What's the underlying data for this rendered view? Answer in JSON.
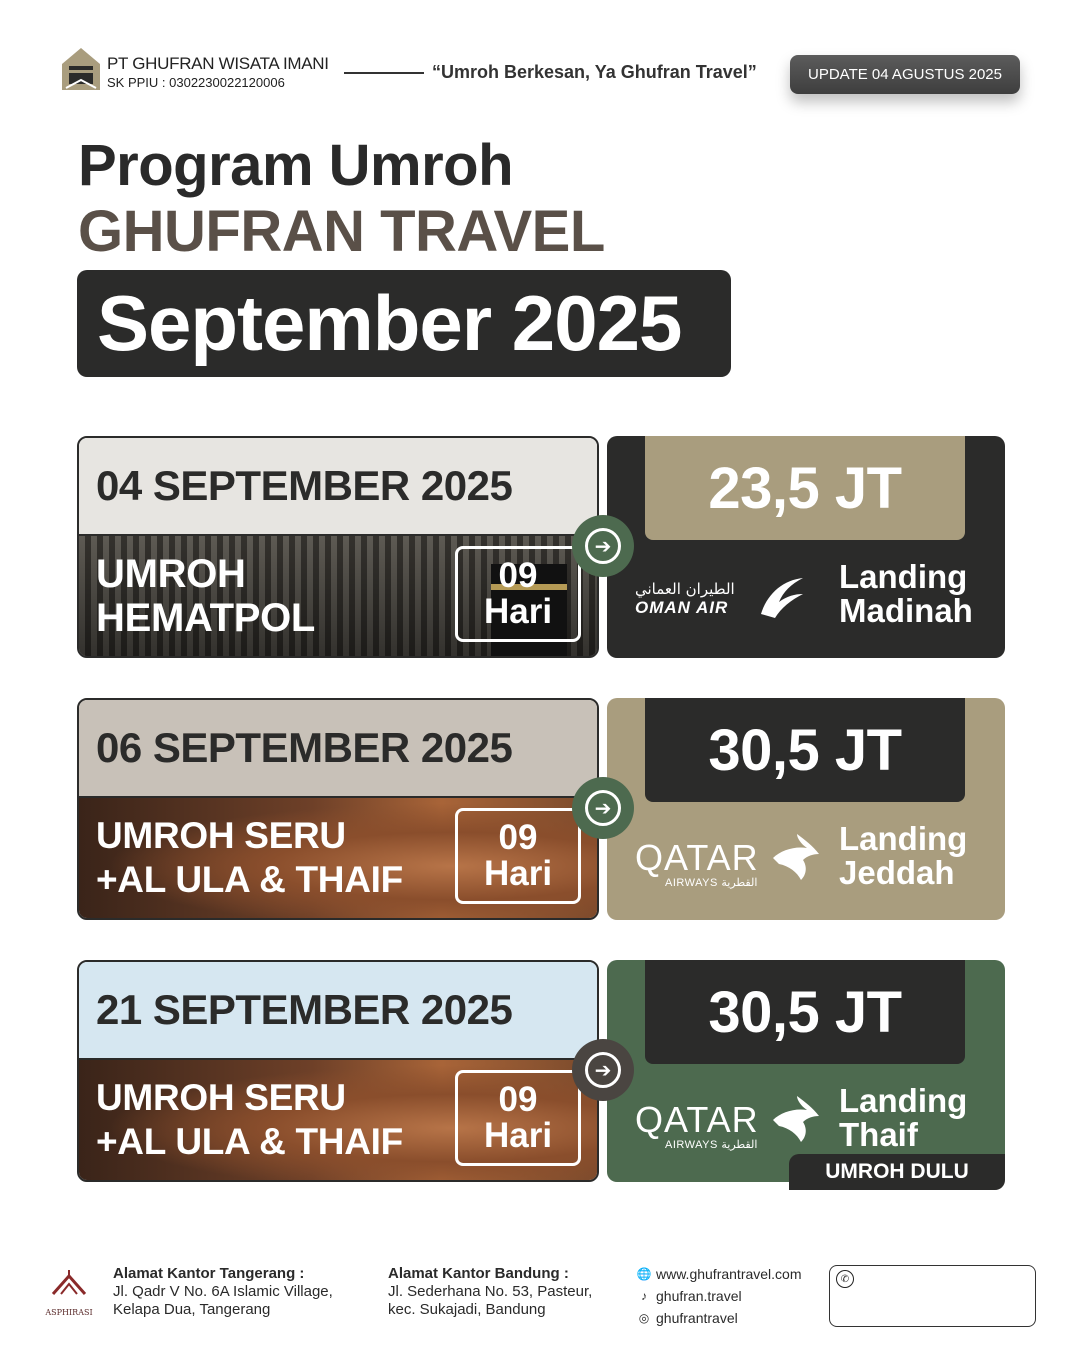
{
  "header": {
    "company_name": "PT GHUFRAN WISATA IMANI",
    "license": "SK PPIU : 0302230022120006",
    "tagline": "“Umroh Berkesan, Ya Ghufran Travel”",
    "update_badge": "UPDATE 04 AGUSTUS 2025"
  },
  "title": {
    "line1": "Program Umroh",
    "line2": "GHUFRAN TRAVEL",
    "month": "September 2025"
  },
  "colors": {
    "dark": "#2b2b2a",
    "tan": "#a99d7e",
    "light_gray": "#e7e5e1",
    "light_tan": "#c8c1b8",
    "light_blue": "#d6e7f1",
    "green": "#4d6a4f"
  },
  "programs": [
    {
      "date": "04 SEPTEMBER 2025",
      "name_line1": "UMROH",
      "name_line2": "HEMATPOL",
      "days_num": "09",
      "days_unit": "Hari",
      "price": "23,5 JT",
      "airline_arabic": "الطيران العماني",
      "airline_name": "OMAN AIR",
      "landing_line1": "Landing",
      "landing_line2": "Madinah",
      "icon": "arrow-right-icon"
    },
    {
      "date": "06 SEPTEMBER 2025",
      "name_line1": "UMROH SERU",
      "name_line2": "+AL ULA & THAIF",
      "days_num": "09",
      "days_unit": "Hari",
      "price": "30,5 JT",
      "airline_name": "QATAR",
      "airline_sub": "AIRWAYS القطرية",
      "landing_line1": "Landing",
      "landing_line2": "Jeddah",
      "icon": "arrow-right-icon"
    },
    {
      "date": "21 SEPTEMBER 2025",
      "name_line1": "UMROH SERU",
      "name_line2": "+AL ULA & THAIF",
      "days_num": "09",
      "days_unit": "Hari",
      "price": "30,5 JT",
      "airline_name": "QATAR",
      "airline_sub": "AIRWAYS القطرية",
      "landing_line1": "Landing",
      "landing_line2": "Thaif",
      "tag": "UMROH DULU",
      "icon": "arrow-right-icon"
    }
  ],
  "footer": {
    "asphirasi": "ASPHIRASI",
    "office_tangerang": {
      "heading": "Alamat Kantor Tangerang :",
      "line1": "Jl. Qadr V No. 6A Islamic Village,",
      "line2": "Kelapa Dua, Tangerang"
    },
    "office_bandung": {
      "heading": "Alamat Kantor Bandung :",
      "line1": "Jl. Sederhana No. 53, Pasteur,",
      "line2": "kec. Sukajadi, Bandung"
    },
    "website": "www.ghufrantravel.com",
    "tiktok": "ghufran.travel",
    "instagram": "ghufrantravel"
  }
}
